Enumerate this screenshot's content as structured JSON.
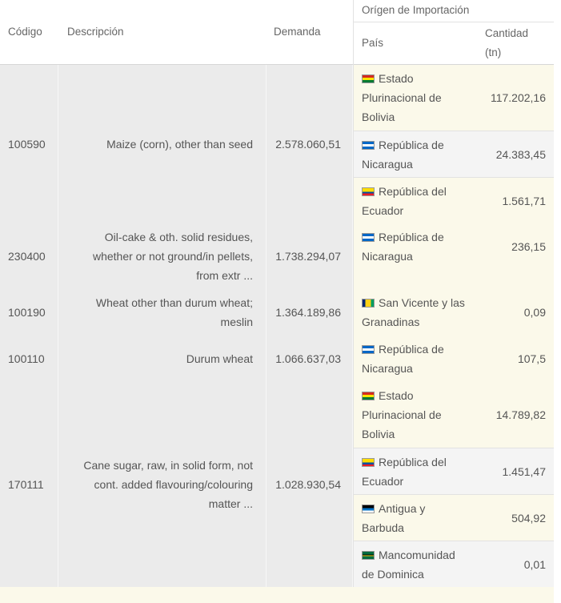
{
  "header": {
    "codigo": "Código",
    "descripcion": "Descripción",
    "demanda": "Demanda",
    "origen": "Orígen de Importación",
    "pais": "País",
    "cantidad_line1": "Cantidad",
    "cantidad_line2": "(tn)"
  },
  "rows": [
    {
      "codigo": "100590",
      "descripcion": [
        "Maize (corn), other than seed"
      ],
      "demanda": "2.578.060,51",
      "origins": [
        {
          "flag": "bolivia-flag-icon",
          "pais": [
            "Estado",
            "Plurinacional de",
            "Bolivia"
          ],
          "cantidad": "117.202,16"
        },
        {
          "flag": "nicaragua-flag-icon",
          "pais": [
            "República de",
            "Nicaragua"
          ],
          "cantidad": "24.383,45"
        },
        {
          "flag": "ecuador-flag-icon",
          "pais": [
            "República del",
            "Ecuador"
          ],
          "cantidad": "1.561,71"
        }
      ]
    },
    {
      "codigo": "230400",
      "descripcion": [
        "Oil-cake & oth. solid residues,",
        "whether or not ground/in pellets,",
        "from extr ..."
      ],
      "demanda": "1.738.294,07",
      "origins": [
        {
          "flag": "nicaragua-flag-icon",
          "pais": [
            "República de",
            "Nicaragua"
          ],
          "cantidad": "236,15"
        }
      ]
    },
    {
      "codigo": "100190",
      "descripcion": [
        "Wheat other than durum wheat;",
        "meslin"
      ],
      "demanda": "1.364.189,86",
      "origins": [
        {
          "flag": "san-vicente-flag-icon",
          "pais": [
            "San Vicente y las",
            "Granadinas"
          ],
          "cantidad": "0,09"
        }
      ]
    },
    {
      "codigo": "100110",
      "descripcion": [
        "Durum wheat"
      ],
      "demanda": "1.066.637,03",
      "origins": [
        {
          "flag": "nicaragua-flag-icon",
          "pais": [
            "República de",
            "Nicaragua"
          ],
          "cantidad": "107,5"
        }
      ]
    },
    {
      "codigo": "170111",
      "descripcion": [
        "Cane sugar, raw, in solid form, not",
        "cont. added flavouring/colouring",
        "matter ..."
      ],
      "demanda": "1.028.930,54",
      "origins": [
        {
          "flag": "bolivia-flag-icon",
          "pais": [
            "Estado",
            "Plurinacional de",
            "Bolivia"
          ],
          "cantidad": "14.789,82"
        },
        {
          "flag": "ecuador-flag-icon",
          "pais": [
            "República del",
            "Ecuador"
          ],
          "cantidad": "1.451,47"
        },
        {
          "flag": "antigua-flag-icon",
          "pais": [
            "Antigua y",
            "Barbuda"
          ],
          "cantidad": "504,92"
        },
        {
          "flag": "dominica-flag-icon",
          "pais": [
            "Mancomunidad",
            "de Dominica"
          ],
          "cantidad": "0,01"
        }
      ]
    }
  ],
  "colors": {
    "left_cells_bg": "#ebebeb",
    "origin_odd_bg": "#fbf9ea",
    "origin_even_bg": "#f4f4f4",
    "border": "#e2e2e2"
  }
}
